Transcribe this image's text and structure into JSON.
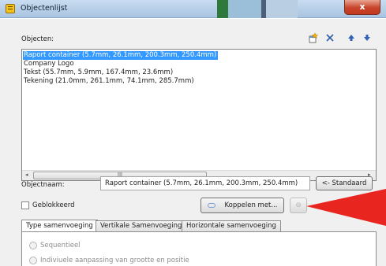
{
  "window": {
    "title": "Objectenlijst",
    "close_label": "x",
    "icon": "app-document-icon"
  },
  "objects": {
    "label": "Objecten:",
    "toolbar": {
      "new_icon": "new-object-icon",
      "delete_icon": "delete-x-icon",
      "up_icon": "arrow-up-icon",
      "down_icon": "arrow-down-icon"
    },
    "items": [
      "Raport container (5.7mm, 26.1mm, 200.3mm, 250.4mm)",
      "Company Logo",
      "Tekst (55.7mm, 5.9mm, 167.4mm, 23.6mm)",
      "Tekening (21.0mm, 261.1mm, 74.1mm, 285.7mm)"
    ],
    "selected_index": 0,
    "scroll": {
      "left_arrow": "◂",
      "right_arrow": "▸",
      "thumb_grip": "III"
    }
  },
  "name_row": {
    "label": "Objectnaam:",
    "value": "Raport container (5.7mm, 26.1mm, 200.3mm, 250.4mm)",
    "standard_button": "<- Standaard"
  },
  "options": {
    "locked_label": "Geblokkeerd",
    "locked_checked": false,
    "link_button": "Koppelen met...",
    "unlink_button": "⊖"
  },
  "tabs": [
    {
      "label": "Type samenvoeging",
      "active": true
    },
    {
      "label": "Vertikale Samenvoeging",
      "active": false
    },
    {
      "label": "Horizontale samenvoeging",
      "active": false
    }
  ],
  "merge_types": [
    {
      "label": "Sequentieel",
      "enabled": false
    },
    {
      "label": "Indiviuele aanpassing van grootte en positie",
      "enabled": false
    }
  ],
  "colors": {
    "selection": "#3399ff",
    "close_button": "#c8432a",
    "annotation_arrow": "#e8251e"
  }
}
